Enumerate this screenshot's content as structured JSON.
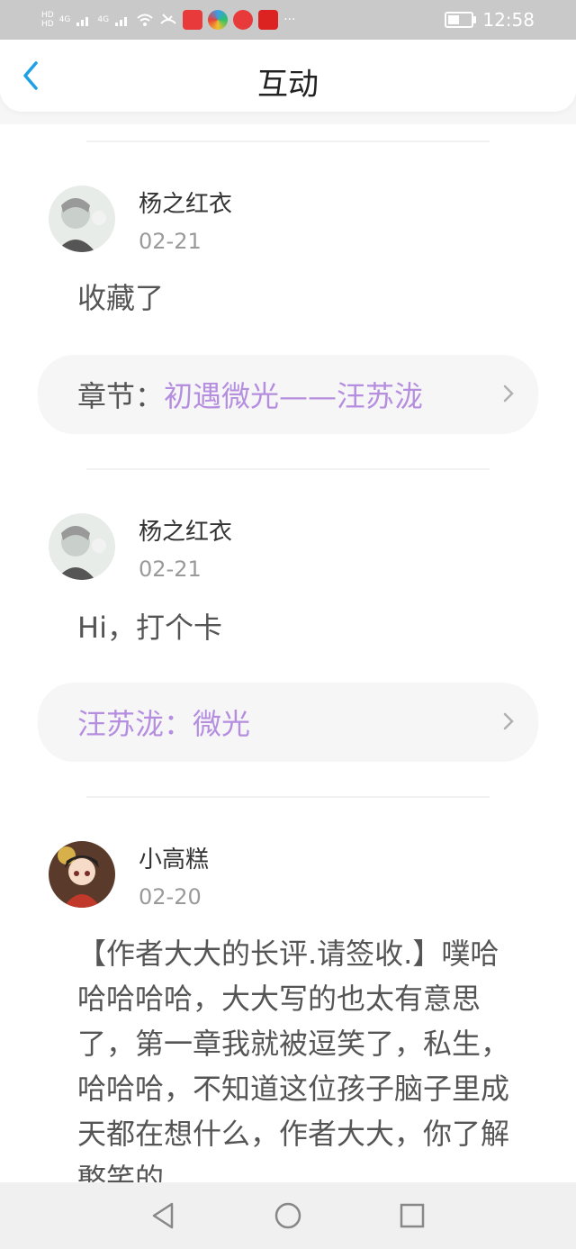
{
  "status_bar": {
    "time": "12:58",
    "left_tags": [
      "HD",
      "HD"
    ],
    "network": [
      "4G",
      "4G"
    ],
    "app_icons": [
      "toutiao-app-icon",
      "browser-app-icon",
      "video-app-icon",
      "news-app-icon"
    ],
    "more": "···"
  },
  "header": {
    "title": "互动"
  },
  "comments": [
    {
      "user": "杨之红衣",
      "date": "02-21",
      "text": "收藏了",
      "ref_label": "章节：",
      "ref_value": "初遇微光——汪苏泷"
    },
    {
      "user": "杨之红衣",
      "date": "02-21",
      "text": "Hi，打个卡",
      "ref_label": "",
      "ref_value": "汪苏泷：微光"
    },
    {
      "user": "小高糕",
      "date": "02-20",
      "text": "【作者大大的长评.请签收.】噗哈哈哈哈哈，大大写的也太有意思了，第一章我就被逗笑了，私生，哈哈哈，不知道这位孩子脑子里成天都在想什么，作者大大，你了解憨笑的"
    }
  ],
  "colors": {
    "accent": "#1ea0e6",
    "ref_link": "#b58ee0",
    "status_bar_bg": "#c9c9c9"
  }
}
